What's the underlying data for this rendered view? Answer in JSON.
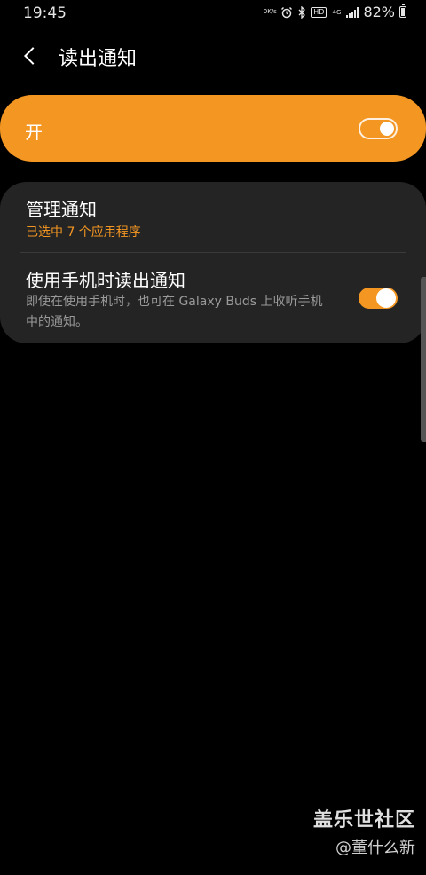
{
  "status_bar": {
    "time": "19:45",
    "net_speed_top": "0",
    "net_speed_unit": "K/s",
    "hd": "HD",
    "network": "4G",
    "battery_pct": "82%"
  },
  "header": {
    "title": "读出通知"
  },
  "master_switch": {
    "label": "开",
    "on": true
  },
  "settings": {
    "manage": {
      "title": "管理通知",
      "subtitle": "已选中 7 个应用程序"
    },
    "read_while_using": {
      "title": "使用手机时读出通知",
      "description": "即使在使用手机时，也可在 Galaxy Buds 上收听手机中的通知。",
      "on": true
    }
  },
  "watermark": {
    "title": "盖乐世社区",
    "author": "@董什么新"
  },
  "colors": {
    "accent": "#f39622",
    "card_bg": "#242424",
    "background": "#000000"
  }
}
